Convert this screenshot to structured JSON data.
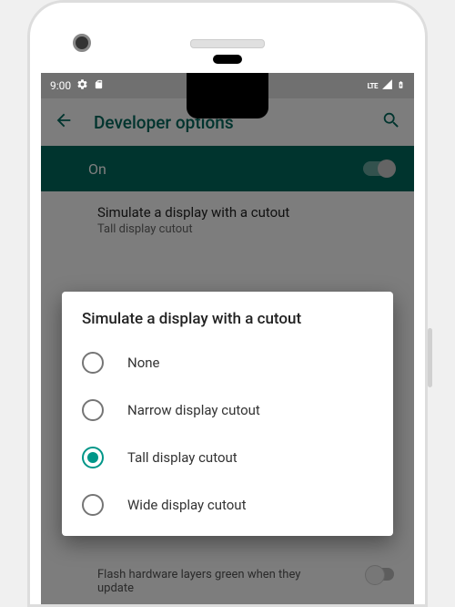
{
  "status": {
    "time": "9:00",
    "lte": "LTE"
  },
  "appBar": {
    "title": "Developer options"
  },
  "toggle": {
    "label": "On"
  },
  "setting": {
    "title": "Simulate a display with a cutout",
    "subtitle": "Tall display cutout"
  },
  "bgItem": {
    "text": "Flash hardware layers green when they update"
  },
  "dialog": {
    "title": "Simulate a display with a cutout",
    "options": [
      {
        "label": "None",
        "selected": false
      },
      {
        "label": "Narrow display cutout",
        "selected": false
      },
      {
        "label": "Tall display cutout",
        "selected": true
      },
      {
        "label": "Wide display cutout",
        "selected": false
      }
    ]
  }
}
